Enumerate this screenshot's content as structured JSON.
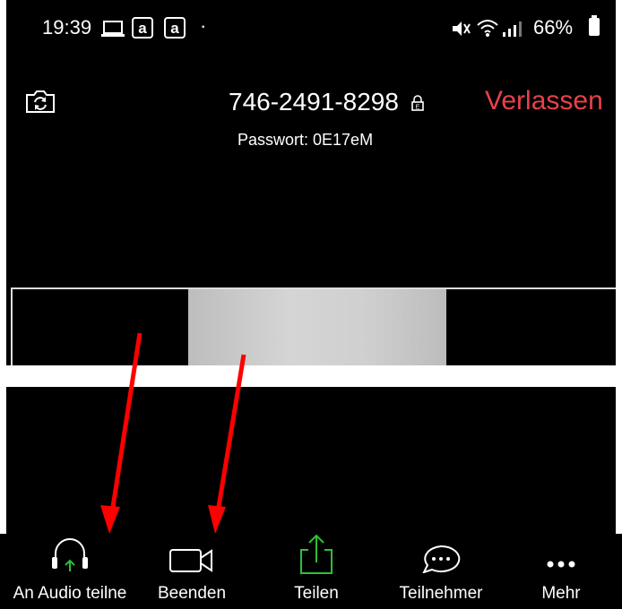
{
  "status_bar": {
    "time": "19:39",
    "separator_dot": "·",
    "battery": "66%",
    "icons": [
      "laptop-icon",
      "amazon-icon",
      "amazon-icon",
      "mute-icon",
      "wifi-icon",
      "signal-icon",
      "battery-icon"
    ]
  },
  "meeting": {
    "id": "746-2491-8298",
    "password_line": "Passwort: 0E17eM",
    "leave_label": "Verlassen"
  },
  "toolbar": {
    "audio_label": "An Audio teilne",
    "video_label": "Beenden",
    "share_label": "Teilen",
    "participants_label": "Teilnehmer",
    "more_label": "Mehr"
  },
  "colors": {
    "leave": "#e8414b",
    "share_green": "#2fbf36",
    "annotation_arrow": "#ff0000"
  }
}
